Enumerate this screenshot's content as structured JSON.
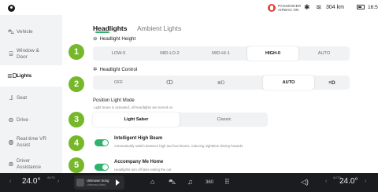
{
  "status": {
    "airbag_text": "PASSENGER\nAIRBAG ON",
    "range": "304 km",
    "time": "16:53",
    "icons": [
      "bluetooth-icon",
      "wifi-icon",
      "battery-icon"
    ]
  },
  "sidebar": {
    "items": [
      {
        "label": "Vehicle",
        "icon": "car-icon"
      },
      {
        "label": "Window &\nDoor",
        "icon": "door-icon"
      },
      {
        "label": "Lights",
        "icon": "light-icon"
      },
      {
        "label": "Seat",
        "icon": "seat-icon"
      },
      {
        "label": "Drive",
        "icon": "steering-icon"
      },
      {
        "label": "Real-time VR\nAssist",
        "icon": "vr-icon"
      },
      {
        "label": "Driver\nAssistance",
        "icon": "assist-icon"
      }
    ],
    "active": "Lights"
  },
  "tabs": [
    {
      "label": "Headlights",
      "active": true
    },
    {
      "label": "Ambient Lights",
      "active": false
    }
  ],
  "headlight_height": {
    "title": "Headlight Height",
    "options": [
      "LOW-5",
      "MID-LO-2",
      "MID-HI-1",
      "HIGH-0",
      "AUTO"
    ],
    "selected": "HIGH-0"
  },
  "headlight_control": {
    "title": "Headlight Control",
    "options": [
      {
        "label": "OFF",
        "icon": null
      },
      {
        "label": "",
        "icon": "parking-light-icon",
        "glyph": "ↀ"
      },
      {
        "label": "",
        "icon": "low-beam-icon",
        "glyph": "≣D"
      },
      {
        "label": "AUTO",
        "icon": null
      },
      {
        "label": "",
        "icon": "high-beam-icon",
        "glyph": "≡D"
      }
    ],
    "selected": "AUTO"
  },
  "position_light": {
    "title": "Position Light Mode",
    "hint": "Light beam is activated, all headlights are turned on",
    "options": [
      "Light Saber",
      "Classic"
    ],
    "selected": "Light Saber"
  },
  "features": [
    {
      "title": "Intelligent High Beam",
      "desc": "Automatically switch between high and low beams, reducing nighttime driving hazards",
      "enabled": true
    },
    {
      "title": "Accompany Me Home",
      "desc": "Headlights turn off later exiting the car",
      "enabled": true
    }
  ],
  "badges": [
    "1",
    "2",
    "3",
    "4",
    "5"
  ],
  "dock": {
    "left_temp": "24.0°",
    "right_temp": "24.0°",
    "auto_label": "AUTO",
    "media_title": "Unknown Song",
    "media_artist": "Unknown Artist",
    "icons": [
      "home-icon",
      "car-icon",
      "music-icon",
      "360-icon",
      "apps-icon",
      "volume-icon"
    ]
  },
  "colors": {
    "accent": "#2db36b",
    "badge": "#76b82a",
    "dock": "#1b1c1f"
  }
}
